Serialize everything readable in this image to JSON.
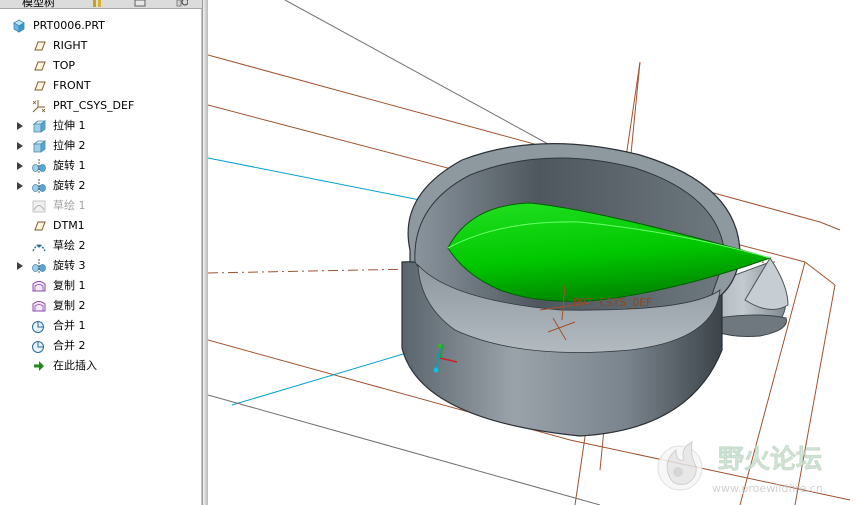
{
  "toolbar": {
    "title": "模型树"
  },
  "model_tree": {
    "root": {
      "label": "PRT0006.PRT",
      "icon": "part-icon"
    },
    "items": [
      {
        "label": "RIGHT",
        "icon": "datum-plane-icon",
        "expandable": false
      },
      {
        "label": "TOP",
        "icon": "datum-plane-icon",
        "expandable": false
      },
      {
        "label": "FRONT",
        "icon": "datum-plane-icon",
        "expandable": false
      },
      {
        "label": "PRT_CSYS_DEF",
        "icon": "coordinate-system-icon",
        "expandable": false
      },
      {
        "label": "拉伸 1",
        "icon": "extrude-icon",
        "expandable": true
      },
      {
        "label": "拉伸 2",
        "icon": "extrude-icon",
        "expandable": true
      },
      {
        "label": "旋转 1",
        "icon": "revolve-icon",
        "expandable": true
      },
      {
        "label": "旋转 2",
        "icon": "revolve-icon",
        "expandable": true
      },
      {
        "label": "草绘 1",
        "icon": "sketch-icon",
        "expandable": false,
        "suppressed": true
      },
      {
        "label": "DTM1",
        "icon": "datum-plane-icon",
        "expandable": false
      },
      {
        "label": "草绘 2",
        "icon": "sketch-icon",
        "expandable": false
      },
      {
        "label": "旋转 3",
        "icon": "revolve-icon",
        "expandable": true
      },
      {
        "label": "复制 1",
        "icon": "copy-surface-icon",
        "expandable": false
      },
      {
        "label": "复制 2",
        "icon": "copy-surface-icon",
        "expandable": false
      },
      {
        "label": "合并 1",
        "icon": "merge-icon",
        "expandable": false
      },
      {
        "label": "合并 2",
        "icon": "merge-icon",
        "expandable": false
      },
      {
        "label": "在此插入",
        "icon": "insert-here-arrow-icon",
        "expandable": false
      }
    ]
  },
  "viewport": {
    "csys_label": "PRT_CSYS_DEF",
    "watermark": {
      "title": "野火论坛",
      "url": "www.proewildfire.cn"
    },
    "colors": {
      "datum_plane": "#a0522d",
      "datum_plane_edge": "#00a0d0",
      "part_body": "#6c7880",
      "surface": "#00d400"
    }
  }
}
